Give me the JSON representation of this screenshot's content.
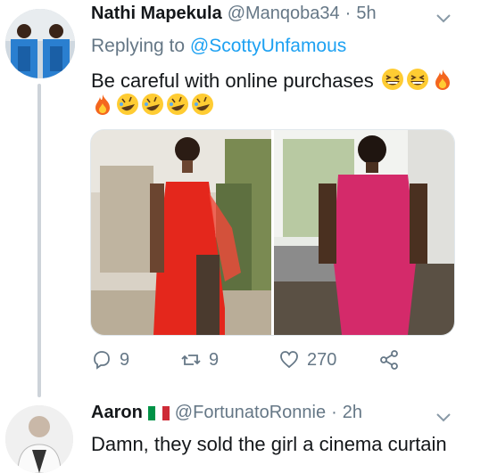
{
  "tweet1": {
    "author_name": "Nathi Mapekula",
    "handle": "@Manqoba34",
    "separator": "·",
    "time": "5h",
    "replying_prefix": "Replying to ",
    "replying_to": "@ScottyUnfamous",
    "text": "Be careful with online purchases",
    "emojis_inline": [
      "grinning-squinting-face",
      "grinning-squinting-face",
      "fire"
    ],
    "emojis_row": [
      "fire",
      "rolling-on-floor-laughing",
      "rolling-on-floor-laughing",
      "rolling-on-floor-laughing",
      "rolling-on-floor-laughing"
    ],
    "stats": {
      "replies": "9",
      "retweets": "9",
      "likes": "270"
    }
  },
  "tweet2": {
    "author_name": "Aaron",
    "flag": "italy-flag",
    "handle": "@FortunatoRonnie",
    "separator": "·",
    "time": "2h",
    "text": "Damn, they sold the girl a cinema curtain"
  },
  "icons": [
    "reply-icon",
    "retweet-icon",
    "like-icon",
    "share-icon",
    "chevron-down-icon"
  ],
  "colors": {
    "link": "#1da1f2",
    "muted": "#657786",
    "text": "#14171a",
    "thread_line": "#cdd3d9"
  }
}
